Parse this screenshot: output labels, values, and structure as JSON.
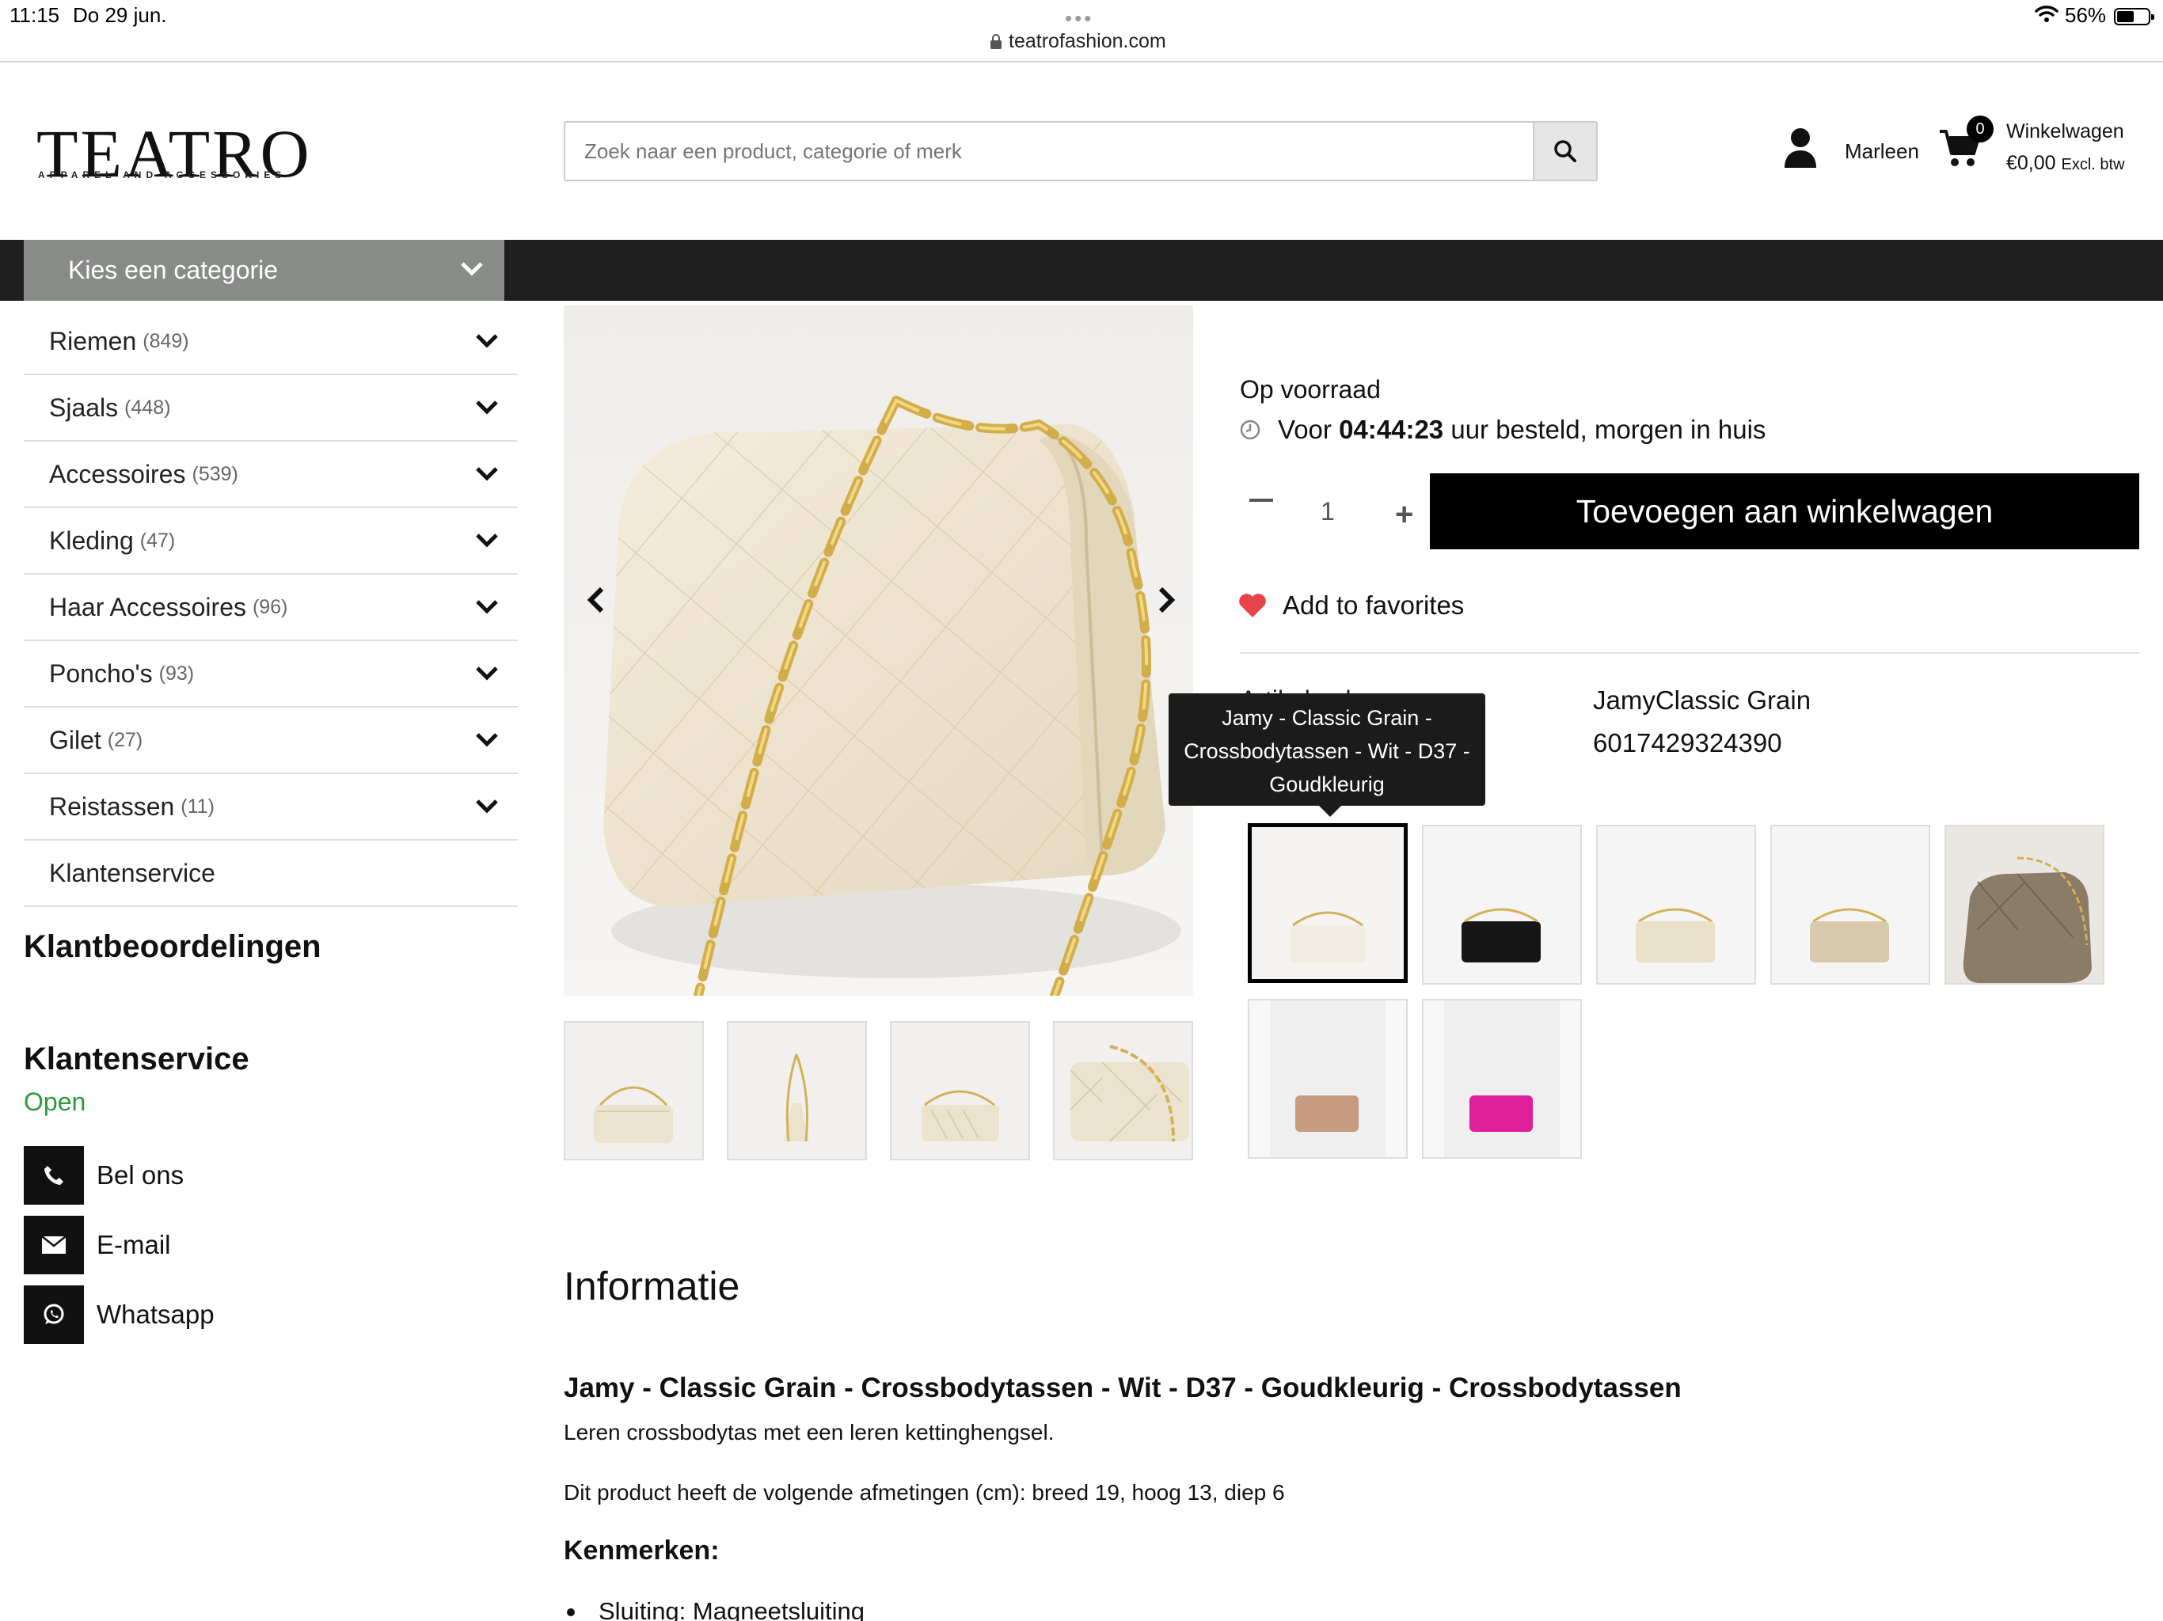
{
  "status_bar": {
    "time": "11:15",
    "date": "Do 29 jun.",
    "url": "teatrofashion.com",
    "battery": "56%",
    "battery_level": 0.56
  },
  "header": {
    "logo": "TEATRO",
    "logo_tagline": "APPAREL AND ACCESSORIES",
    "search_placeholder": "Zoek naar een product, categorie of merk",
    "user_name": "Marleen",
    "cart_count": "0",
    "cart_label": "Winkelwagen",
    "cart_total": "€0,00",
    "cart_tax_note": "Excl. btw"
  },
  "nav": {
    "category_dropdown": "Kies een categorie"
  },
  "sidebar": {
    "items": [
      {
        "label": "Riemen",
        "count": "(849)"
      },
      {
        "label": "Sjaals",
        "count": "(448)"
      },
      {
        "label": "Accessoires",
        "count": "(539)"
      },
      {
        "label": "Kleding",
        "count": "(47)"
      },
      {
        "label": "Haar Accessoires",
        "count": "(96)"
      },
      {
        "label": "Poncho's",
        "count": "(93)"
      },
      {
        "label": "Gilet",
        "count": "(27)"
      },
      {
        "label": "Reistassen",
        "count": "(11)"
      },
      {
        "label": "Klantenservice",
        "count": ""
      }
    ],
    "reviews_heading": "Klantbeoordelingen",
    "service_heading": "Klantenservice",
    "service_status": "Open",
    "contact": [
      {
        "label": "Bel ons",
        "icon": "phone-icon"
      },
      {
        "label": "E-mail",
        "icon": "envelope-icon"
      },
      {
        "label": "Whatsapp",
        "icon": "whatsapp-icon"
      }
    ]
  },
  "product": {
    "stock": "Op voorraad",
    "delivery_prefix": "Voor",
    "delivery_time": "04:44:23",
    "delivery_suffix": "uur besteld, morgen in huis",
    "quantity": "1",
    "add_to_cart": "Toevoegen aan winkelwagen",
    "add_to_favorites": "Add to favorites",
    "spec_label": "Artikelcode",
    "spec_value_1": "JamyClassic Grain",
    "spec_value_2": "6017429324390",
    "tooltip": "Jamy - Classic Grain - Crossbodytassen - Wit - D37 - Goudkleurig",
    "variant_colors": [
      "#f1ede3",
      "#161616",
      "#e9e2c9",
      "#d8c9ad",
      "#8a7c67",
      "#c79a82",
      "#e0209b"
    ]
  },
  "info": {
    "heading": "Informatie",
    "title": "Jamy - Classic Grain - Crossbodytassen - Wit - D37 - Goudkleurig - Crossbodytassen",
    "description": "Leren crossbodytas met een leren kettinghengsel.",
    "dimensions": "Dit product heeft de volgende afmetingen (cm): breed 19, hoog 13, diep 6",
    "features_heading": "Kenmerken:",
    "feature_1": "Sluiting: Magneetsluiting"
  }
}
